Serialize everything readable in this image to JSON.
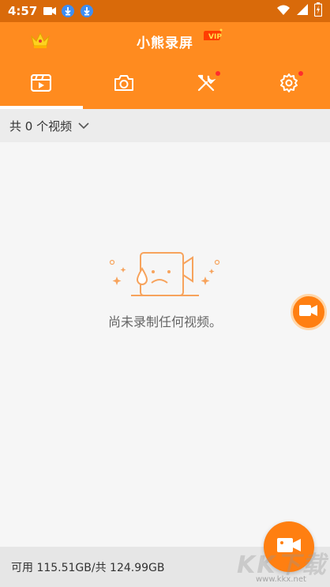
{
  "status_bar": {
    "time": "4:57",
    "battery": "⚡"
  },
  "app_bar": {
    "title": "小熊录屏",
    "vip": "VIP"
  },
  "tabs": [
    {
      "name": "videos",
      "icon": "video-icon",
      "active": true
    },
    {
      "name": "screenshots",
      "icon": "camera-icon"
    },
    {
      "name": "tools",
      "icon": "tools-icon",
      "badge": true
    },
    {
      "name": "settings",
      "icon": "gear-icon",
      "badge": true
    }
  ],
  "filter": {
    "label": "共 0 个视频"
  },
  "empty_state": {
    "message": "尚未录制任何视频。"
  },
  "storage": {
    "text": "可用 115.51GB/共 124.99GB"
  },
  "watermark": {
    "brand": "KK下载",
    "url": "www.kkx.net"
  },
  "colors": {
    "status_bar": "#d96a0a",
    "accent": "#ff8b1f",
    "fab": "#ff7f11"
  }
}
